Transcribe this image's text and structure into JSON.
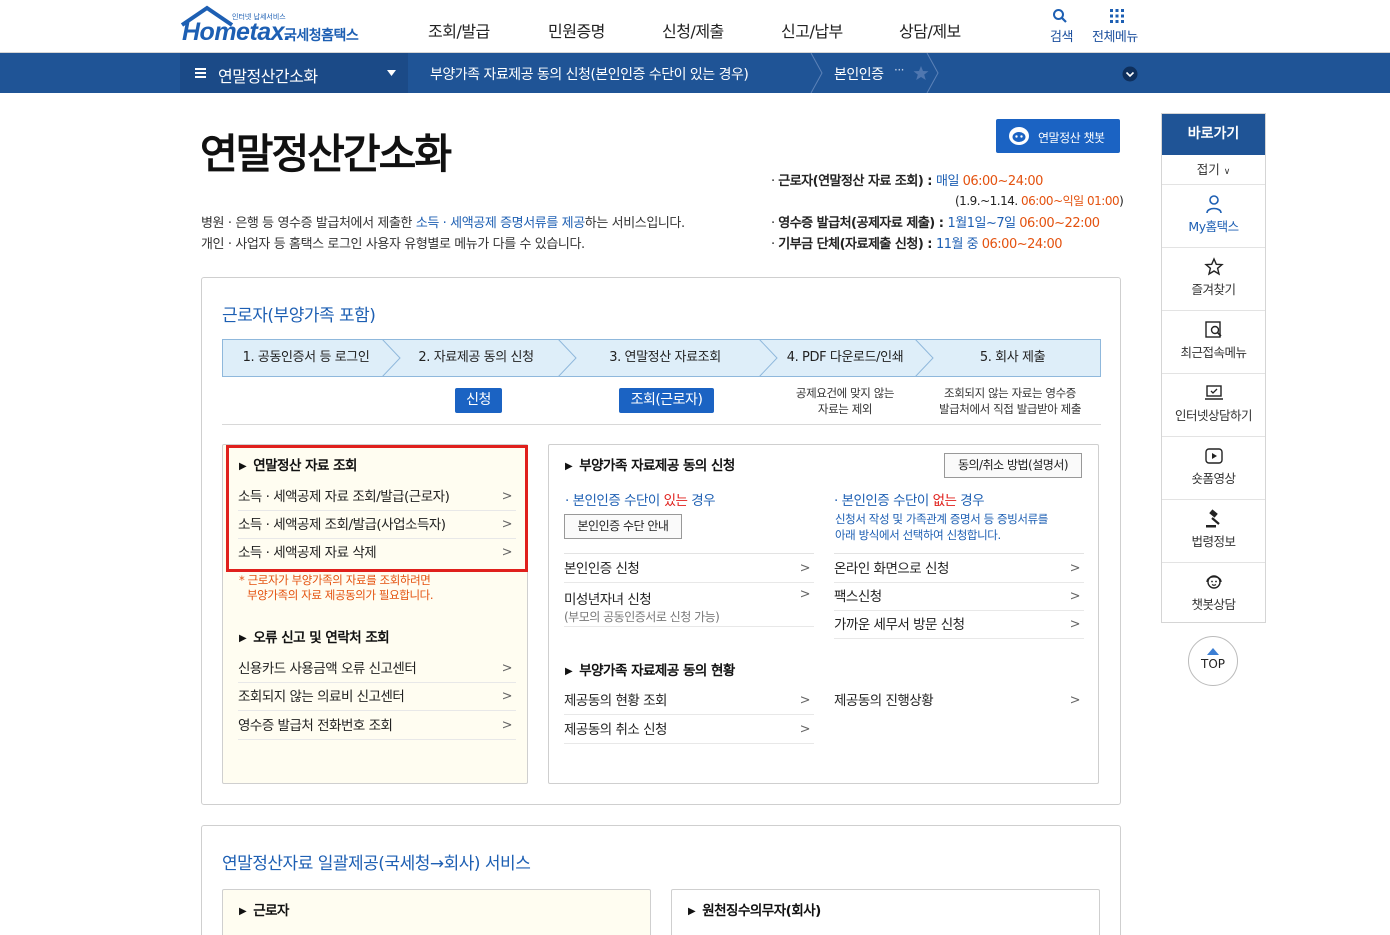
{
  "header": {
    "logo_small": "인터넷 납세서비스",
    "logo_word": "Hometax.",
    "logo_kr": "국세청홈택스",
    "nav": [
      "조회/발급",
      "민원증명",
      "신청/제출",
      "신고/납부",
      "상담/제보"
    ],
    "search_label": "검색",
    "allmenu_label": "전체메뉴"
  },
  "breadcrumb": {
    "menu": "연말정산간소화",
    "path1": "부양가족 자료제공 동의 신청(본인인증 수단이 있는 경우)",
    "path2": "본인인증",
    "ellipsis": "···"
  },
  "page": {
    "title": "연말정산간소화",
    "chatbot_button": "연말정산 챗봇",
    "desc1_a": "병원 · 은행 등 영수증 발급처에서 제출한 ",
    "desc1_b": "소득 · 세액공제 증명서류를 제공",
    "desc1_c": "하는 서비스입니다.",
    "desc2": "개인 · 사업자 등 홈택스 로그인 사용자 유형별로 메뉴가 다를 수 있습니다.",
    "info": [
      {
        "label": "근로자(연말정산 자료 조회) : ",
        "period": "매일 ",
        "time": "06:00~24:00"
      },
      {
        "label": "",
        "period": "(1.9.~1.14. ",
        "time": "06:00~익일 01:00",
        "tail": ")"
      },
      {
        "label": "영수증 발급처(공제자료 제출) : ",
        "period": "1월1일~7일 ",
        "time": "06:00~22:00"
      },
      {
        "label": "기부금 단체(자료제출 신청) : ",
        "period": "11월 중 ",
        "time": "06:00~24:00"
      }
    ]
  },
  "worker": {
    "title": "근로자(부양가족 포함)",
    "steps": [
      "1. 공동인증서 등 로그인",
      "2. 자료제공 동의 신청",
      "3. 연말정산 자료조회",
      "4. PDF 다운로드/인쇄",
      "5. 회사 제출"
    ],
    "chip_apply": "신청",
    "chip_query": "조회(근로자)",
    "note4": [
      "공제요건에 맞지 않는",
      "자료는 제외"
    ],
    "note5": [
      "조회되지 않는 자료는 영수증",
      "발급처에서 직접 발급받아 제출"
    ],
    "left": {
      "h1": "연말정산 자료 조회",
      "links1": [
        "소득 · 세액공제 자료 조회/발급(근로자)",
        "소득 · 세액공제 조회/발급(사업소득자)",
        "소득 · 세액공제 자료 삭제"
      ],
      "note": [
        "* 근로자가 부양가족의 자료를 조회하려면",
        "부양가족의 자료 제공동의가 필요합니다."
      ],
      "h2": "오류 신고 및 연락처 조회",
      "links2": [
        "신용카드 사용금액 오류 신고센터",
        "조회되지 않는 의료비 신고센터",
        "영수증 발급처 전화번호 조회"
      ]
    },
    "right": {
      "h1": "부양가족 자료제공 동의 신청",
      "method_btn": "동의/취소 방법(설명서)",
      "has_title_a": "본인인증 수단이 ",
      "has_title_b": "있는",
      "has_title_c": " 경우",
      "guide_btn": "본인인증 수단 안내",
      "none_title_a": "본인인증 수단이 ",
      "none_title_b": "없는",
      "none_title_c": " 경우",
      "none_desc": [
        "신청서 작성 및 가족관계 증명서 등 증빙서류를",
        "아래 방식에서 선택하여 신청합니다."
      ],
      "links_has": [
        "본인인증 신청",
        "미성년자녀 신청"
      ],
      "minor_sub": "(부모의 공동인증서로 신청 가능)",
      "links_none": [
        "온라인 화면으로 신청",
        "팩스신청",
        "가까운 세무서 방문 신청"
      ],
      "h2": "부양가족 자료제공 동의 현황",
      "status_left": [
        "제공동의 현황 조회",
        "제공동의 취소 신청"
      ],
      "status_right": [
        "제공동의 진행상황"
      ]
    }
  },
  "bulk": {
    "title": "연말정산자료 일괄제공(국세청→회사) 서비스",
    "left_h": "근로자",
    "right_h": "원천징수의무자(회사)"
  },
  "quick": {
    "title": "바로가기",
    "fold": "접기",
    "items": [
      "My홈택스",
      "즐겨찾기",
      "최근접속메뉴",
      "인터넷상담하기",
      "숏폼영상",
      "법령정보",
      "챗봇상담"
    ],
    "top": "TOP"
  }
}
